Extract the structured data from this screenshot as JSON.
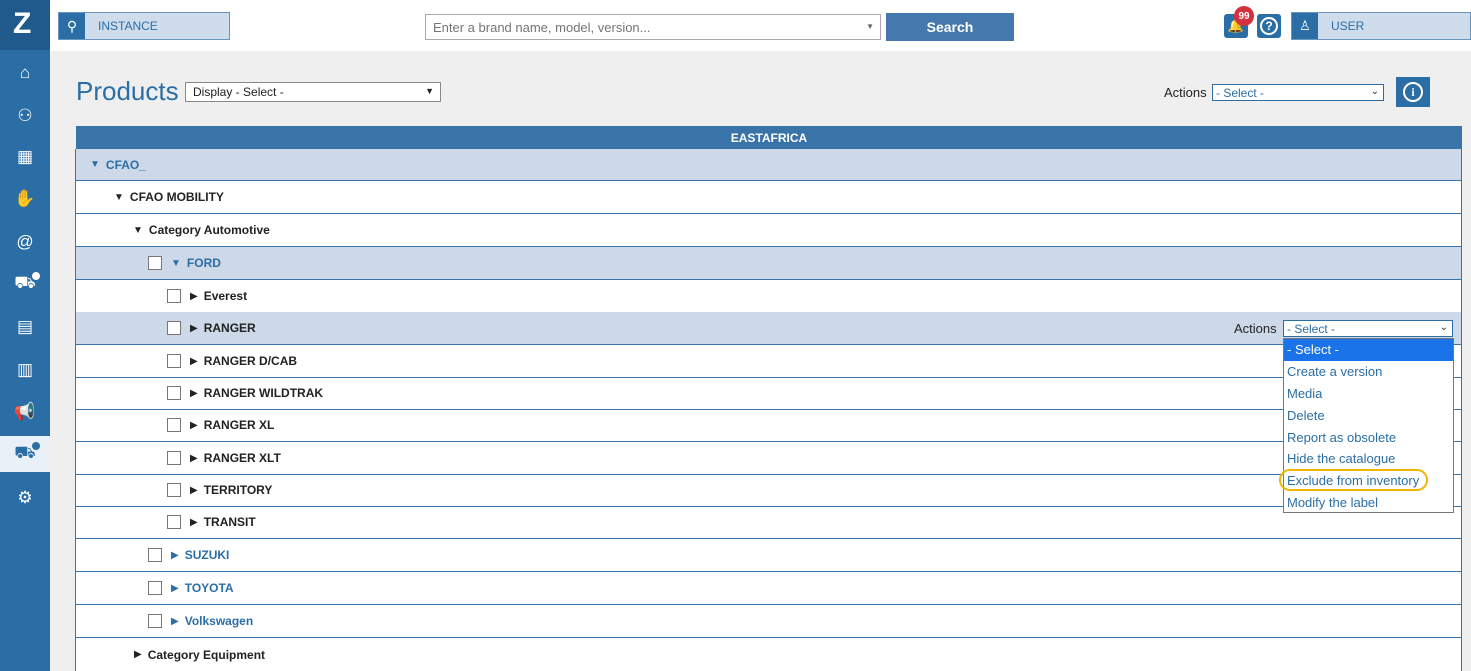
{
  "sidebar": {
    "logo": "Z",
    "items": [
      {
        "icon": "home-icon",
        "glyph": "⌂"
      },
      {
        "icon": "users-icon",
        "glyph": "⚇"
      },
      {
        "icon": "calendar-icon",
        "glyph": "▦"
      },
      {
        "icon": "handshake-icon",
        "glyph": "✋"
      },
      {
        "icon": "at-icon",
        "glyph": "@"
      },
      {
        "icon": "car-chat-icon",
        "glyph": "⛟"
      },
      {
        "icon": "table-icon",
        "glyph": "▤"
      },
      {
        "icon": "chart-icon",
        "glyph": "▥"
      },
      {
        "icon": "megaphone-icon",
        "glyph": "📢"
      },
      {
        "icon": "car-active-icon",
        "glyph": "⛟"
      },
      {
        "icon": "settings-icon",
        "glyph": "⚙"
      }
    ]
  },
  "topbar": {
    "instance_label": "INSTANCE",
    "search_placeholder": "Enter a brand name, model, version...",
    "search_button": "Search",
    "notification_count": "99",
    "help_glyph": "?",
    "user_label": "USER"
  },
  "page": {
    "title": "Products",
    "display_select": "Display - Select -",
    "actions_label": "Actions",
    "actions_select": "- Select -",
    "info_glyph": "i"
  },
  "table": {
    "header": "EASTAFRICA",
    "rows": [
      {
        "label": "CFAO_",
        "kind": "root",
        "open": true
      },
      {
        "label": "CFAO MOBILITY",
        "kind": "group",
        "open": true
      },
      {
        "label": "Category Automotive",
        "kind": "category",
        "open": true
      },
      {
        "label": "FORD",
        "kind": "brand",
        "open": true
      },
      {
        "label": "Everest",
        "kind": "model"
      },
      {
        "label": "RANGER",
        "kind": "model"
      },
      {
        "label": "RANGER D/CAB",
        "kind": "model"
      },
      {
        "label": "RANGER WILDTRAK",
        "kind": "model"
      },
      {
        "label": "RANGER XL",
        "kind": "model"
      },
      {
        "label": "RANGER XLT",
        "kind": "model"
      },
      {
        "label": "TERRITORY",
        "kind": "model"
      },
      {
        "label": "TRANSIT",
        "kind": "model"
      },
      {
        "label": "SUZUKI",
        "kind": "brand"
      },
      {
        "label": "TOYOTA",
        "kind": "brand"
      },
      {
        "label": "Volkswagen",
        "kind": "brand"
      },
      {
        "label": "Category Equipment",
        "kind": "category"
      }
    ],
    "row_actions_label": "Actions",
    "row_actions_select": "- Select -",
    "row_actions_options": [
      "- Select -",
      "Create a version",
      "Media",
      "Delete",
      "Report as obsolete",
      "Hide the catalogue",
      "Exclude from inventory",
      "Modify the label"
    ]
  }
}
